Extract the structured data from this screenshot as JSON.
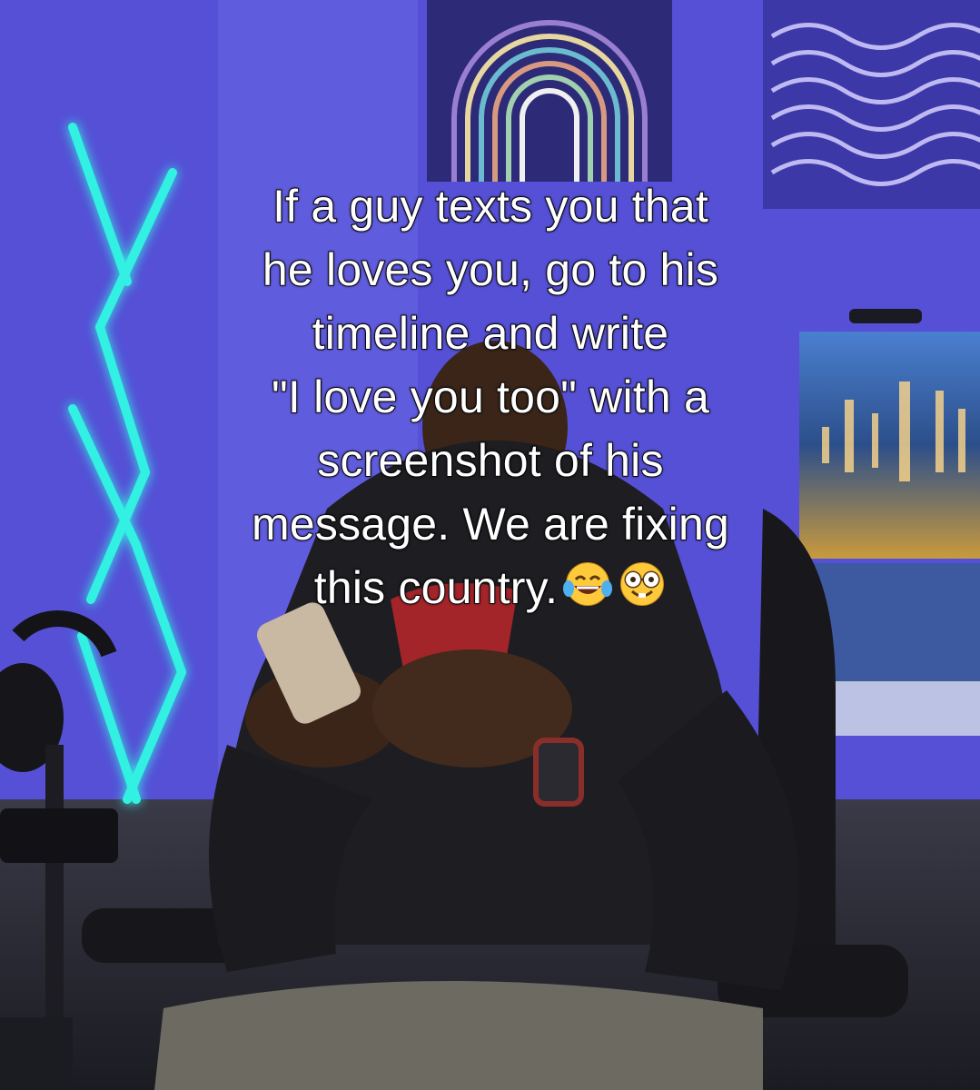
{
  "caption": {
    "lines": [
      "If a guy texts you that",
      "he loves you, go to his",
      "timeline and write",
      "\"I love you too\" with a",
      "screenshot of his",
      "message. We are fixing",
      "this country."
    ]
  },
  "emojis": [
    "tears-of-joy-emoji",
    "nerd-face-emoji"
  ],
  "colors": {
    "wall": "#4a46c4",
    "neon": "#2ff3e0",
    "hoodie": "#1d1d22",
    "chair": "#18181c"
  }
}
